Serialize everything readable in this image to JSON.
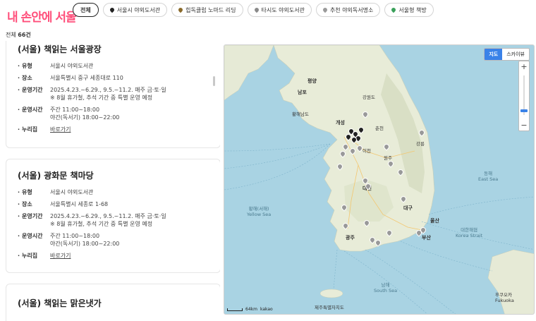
{
  "header": {
    "logo": "내 손안에 서울",
    "filters": [
      {
        "label": "전체",
        "active": true,
        "icon": "",
        "color": ""
      },
      {
        "label": "서울시 야외도서관",
        "active": false,
        "icon": "map-pin-icon",
        "color": "#222222"
      },
      {
        "label": "힙독클럽 노마드 리딩",
        "active": false,
        "icon": "map-pin-icon",
        "color": "#8a6a2a"
      },
      {
        "label": "타시도 야외도서관",
        "active": false,
        "icon": "map-pin-icon",
        "color": "#8a8a8a"
      },
      {
        "label": "추천 야외독서명소",
        "active": false,
        "icon": "map-pin-icon",
        "color": "#9a9a9a"
      },
      {
        "label": "서울형 책방",
        "active": false,
        "icon": "map-pin-icon",
        "color": "#3aa05a"
      }
    ]
  },
  "total": {
    "label": "전체",
    "count": "66건"
  },
  "cards": [
    {
      "title": "(서울) 책읽는 서울광장",
      "type_label": "유형",
      "type": "서울시 야외도서관",
      "place_label": "장소",
      "place": "서울특별시 중구 세종대로 110",
      "period_label": "운영기간",
      "period": "2025.4.23.~6.29., 9.5.~11.2. 매주 금·토·일",
      "period_note": "※ 8월 휴가철, 추석 기간 중 특별 운영 예정",
      "hours_label": "운영시간",
      "hours_day": "주간 11:00~18:00",
      "hours_night": "야간(독서기) 18:00~22:00",
      "site_label": "누리집",
      "site_link": "바로가기"
    },
    {
      "title": "(서울) 광화문 책마당",
      "type_label": "유형",
      "type": "서울시 야외도서관",
      "place_label": "장소",
      "place": "서울특별시 세종로 1-68",
      "period_label": "운영기간",
      "period": "2025.4.23.~6.29., 9.5.~11.2. 매주 금·토·일",
      "period_note": "※ 8월 휴가철, 추석 기간 중 특별 운영 예정",
      "hours_label": "운영시간",
      "hours_day": "주간 11:00~18:00",
      "hours_night": "야간(독서기) 18:00~22:00",
      "site_label": "누리집",
      "site_link": "바로가기"
    },
    {
      "title": "(서울) 책읽는 맑은냇가"
    }
  ],
  "map": {
    "toggle_map": "지도",
    "toggle_sky": "스카이뷰",
    "zoom_in": "+",
    "zoom_out": "−",
    "scale": "64km",
    "brand": "kakao",
    "labels": [
      {
        "text": "평양",
        "cls": "city"
      },
      {
        "text": "남포",
        "cls": "city"
      },
      {
        "text": "강원도",
        "cls": ""
      },
      {
        "text": "황해남도",
        "cls": ""
      },
      {
        "text": "개성",
        "cls": "city"
      },
      {
        "text": "춘천",
        "cls": ""
      },
      {
        "text": "강릉",
        "cls": ""
      },
      {
        "text": "이천",
        "cls": ""
      },
      {
        "text": "원주",
        "cls": ""
      },
      {
        "text": "대전",
        "cls": "city"
      },
      {
        "text": "대구",
        "cls": "city"
      },
      {
        "text": "울산",
        "cls": "city"
      },
      {
        "text": "광주",
        "cls": "city"
      },
      {
        "text": "부산",
        "cls": "city"
      },
      {
        "text": "동해",
        "cls": "sea"
      },
      {
        "text": "East Sea",
        "cls": "sea"
      },
      {
        "text": "황해(서해)",
        "cls": "sea"
      },
      {
        "text": "Yellow Sea",
        "cls": "sea"
      },
      {
        "text": "대한해협",
        "cls": "sea"
      },
      {
        "text": "Korea Strait",
        "cls": "sea"
      },
      {
        "text": "남해",
        "cls": "sea"
      },
      {
        "text": "South Sea",
        "cls": "sea"
      },
      {
        "text": "제주특별자치도",
        "cls": ""
      },
      {
        "text": "후쿠오카",
        "cls": ""
      },
      {
        "text": "Fukuoka",
        "cls": ""
      }
    ]
  },
  "colors": {
    "accent": "#ff4f7b",
    "map_active": "#3a82e8",
    "sea": "#a9d3e3",
    "land": "#e8ecd8"
  }
}
